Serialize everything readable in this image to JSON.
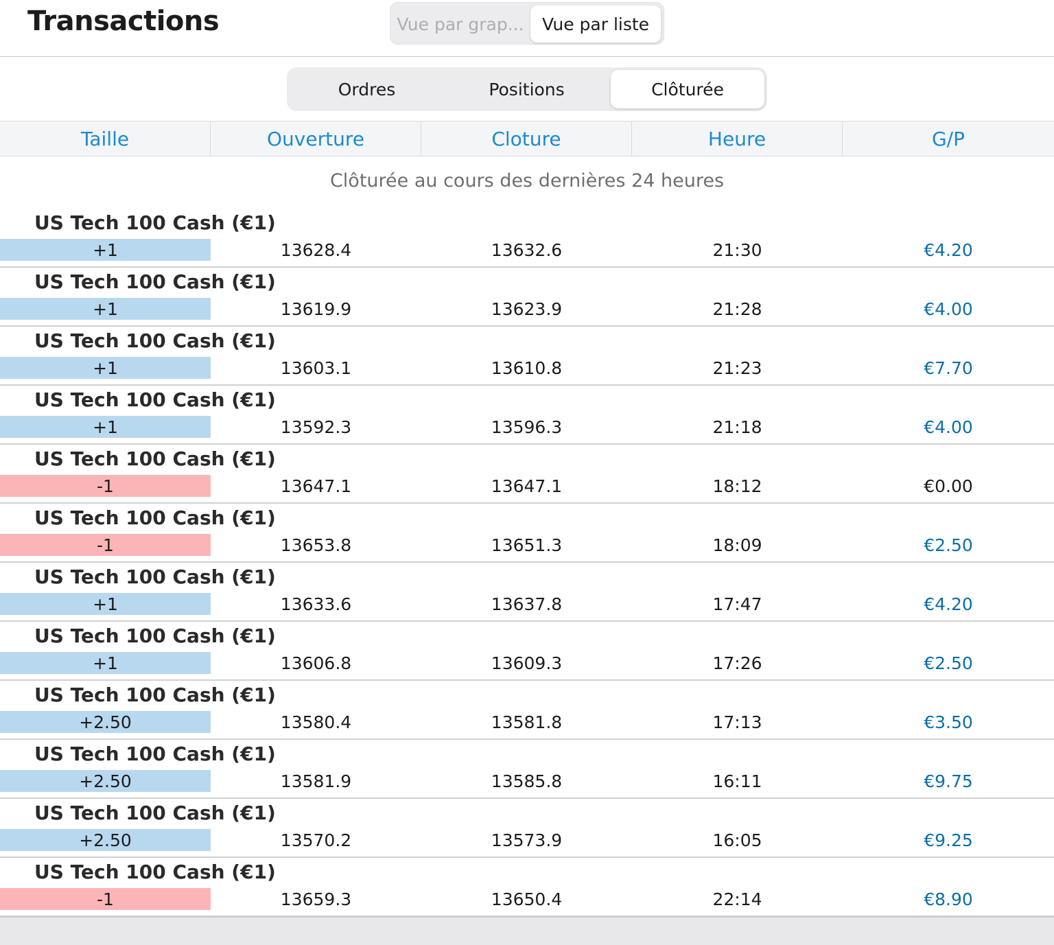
{
  "header": {
    "title": "Transactions",
    "view_options": [
      "Vue par grap...",
      "Vue par liste"
    ],
    "active_view": "Vue par liste"
  },
  "tabs": [
    "Ordres",
    "Positions",
    "Clôturée"
  ],
  "active_tab": "Clôturée",
  "columns": [
    "Taille",
    "Ouverture",
    "Cloture",
    "Heure",
    "G/P"
  ],
  "section_label": "Clôturée au cours des dernières 24 heures",
  "colors": {
    "accent": "#1a8bd0",
    "profit_text": "#0b6ea8",
    "buy_size_bg": "#b8d8ef",
    "sell_size_bg": "#fcb5b7"
  },
  "trades": [
    {
      "instrument": "US Tech 100 Cash (€1)",
      "size": "+1",
      "direction": "buy",
      "open": "13628.4",
      "close": "13632.6",
      "time": "21:30",
      "pl": "€4.20"
    },
    {
      "instrument": "US Tech 100 Cash (€1)",
      "size": "+1",
      "direction": "buy",
      "open": "13619.9",
      "close": "13623.9",
      "time": "21:28",
      "pl": "€4.00"
    },
    {
      "instrument": "US Tech 100 Cash (€1)",
      "size": "+1",
      "direction": "buy",
      "open": "13603.1",
      "close": "13610.8",
      "time": "21:23",
      "pl": "€7.70"
    },
    {
      "instrument": "US Tech 100 Cash (€1)",
      "size": "+1",
      "direction": "buy",
      "open": "13592.3",
      "close": "13596.3",
      "time": "21:18",
      "pl": "€4.00"
    },
    {
      "instrument": "US Tech 100 Cash (€1)",
      "size": "-1",
      "direction": "sell",
      "open": "13647.1",
      "close": "13647.1",
      "time": "18:12",
      "pl": "€0.00"
    },
    {
      "instrument": "US Tech 100 Cash (€1)",
      "size": "-1",
      "direction": "sell",
      "open": "13653.8",
      "close": "13651.3",
      "time": "18:09",
      "pl": "€2.50"
    },
    {
      "instrument": "US Tech 100 Cash (€1)",
      "size": "+1",
      "direction": "buy",
      "open": "13633.6",
      "close": "13637.8",
      "time": "17:47",
      "pl": "€4.20"
    },
    {
      "instrument": "US Tech 100 Cash (€1)",
      "size": "+1",
      "direction": "buy",
      "open": "13606.8",
      "close": "13609.3",
      "time": "17:26",
      "pl": "€2.50"
    },
    {
      "instrument": "US Tech 100 Cash (€1)",
      "size": "+2.50",
      "direction": "buy",
      "open": "13580.4",
      "close": "13581.8",
      "time": "17:13",
      "pl": "€3.50"
    },
    {
      "instrument": "US Tech 100 Cash (€1)",
      "size": "+2.50",
      "direction": "buy",
      "open": "13581.9",
      "close": "13585.8",
      "time": "16:11",
      "pl": "€9.75"
    },
    {
      "instrument": "US Tech 100 Cash (€1)",
      "size": "+2.50",
      "direction": "buy",
      "open": "13570.2",
      "close": "13573.9",
      "time": "16:05",
      "pl": "€9.25"
    },
    {
      "instrument": "US Tech 100 Cash (€1)",
      "size": "-1",
      "direction": "sell",
      "open": "13659.3",
      "close": "13650.4",
      "time": "22:14",
      "pl": "€8.90"
    }
  ]
}
